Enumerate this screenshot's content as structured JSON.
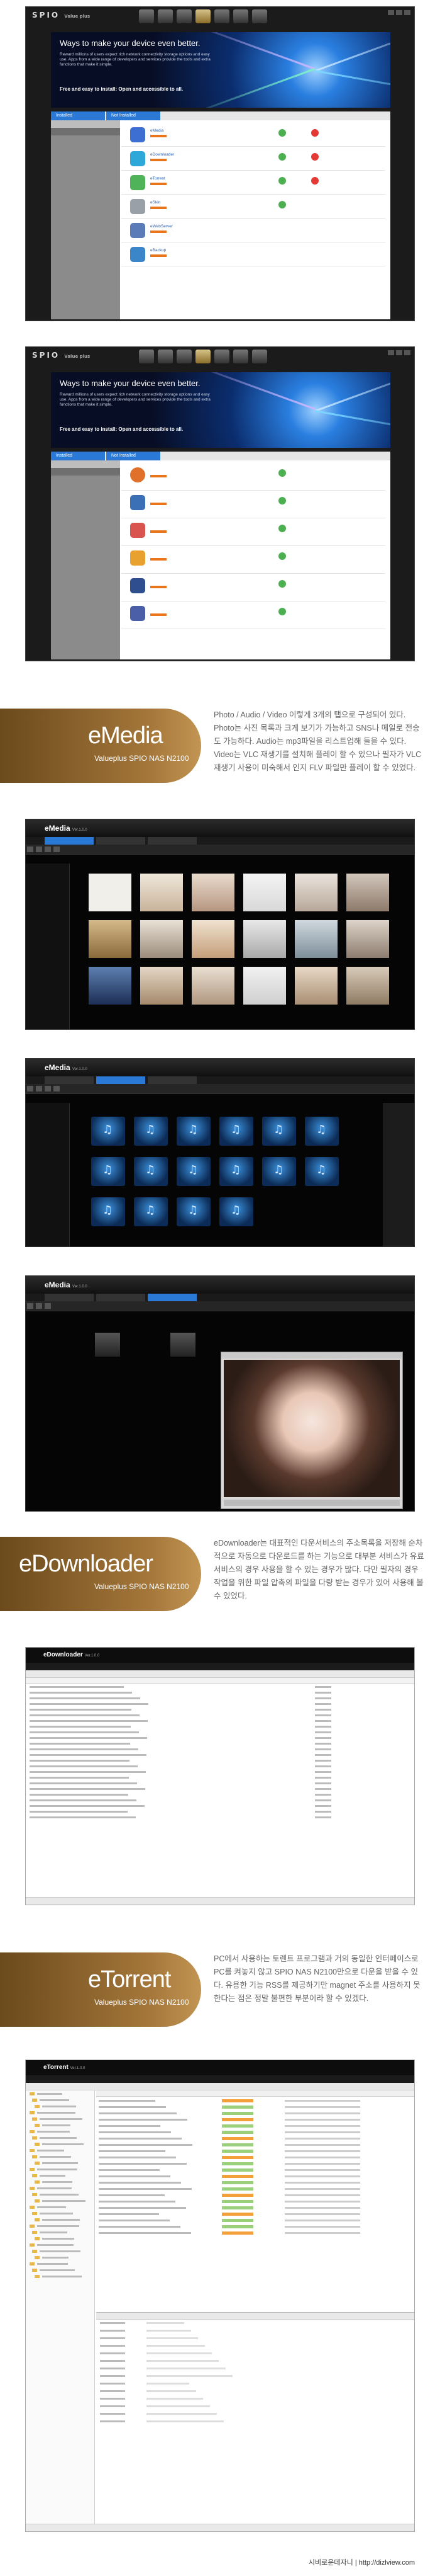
{
  "store1": {
    "brand": "SPIO",
    "brand_sub": "Value plus",
    "banner_title": "Ways to make your device even better.",
    "banner_text": "Reward millions of users expect rich network connectivity storage options and easy use. Apps from a wide range of developers and services provide the tools and extra functions that make it simple.",
    "banner_tag": "Free and easy to install: Open and accessible to all.",
    "tabs": [
      "Installed",
      "Not Installed"
    ],
    "apps": [
      "eMedia",
      "eDownloader",
      "eTorrent",
      "eSkin",
      "eWebServer",
      "eBackup"
    ]
  },
  "emedia": {
    "title": "eMedia",
    "subtitle": "Valueplus SPIO NAS N2100",
    "desc": "Photo / Audio / Video 이렇게 3개의 탭으로 구성되어 있다. Photo는 사진 목록과 크게 보기가 가능하고 SNS나 메일로 전송도 가능하다. Audio는 mp3파일을 리스트업해 들을 수 있다. Video는 VLC 재생기를 설치해 플레이 할 수 있으나 필자가 VLC 재생기 사용이 미숙해서 인지 FLV 파일만 플레이 할 수 있었다.",
    "app_logo": "eMedia",
    "app_ver": "Ver.1.0.0"
  },
  "edownloader": {
    "title": "eDownloader",
    "subtitle": "Valueplus SPIO NAS N2100",
    "desc": "eDownloader는 대표적인 다운서비스의 주소목록을 저장해 순차적으로 자동으로 다운로드를 하는 기능으로 대부분 서비스가 유료 서비스의 경우 사용을 할 수 있는 경우가 많다. 다만 필자의 경우 작업을 위한 파일 압축의 파일을 다량 받는 경우가 있어 사용해 볼 수 있었다.",
    "app_logo": "eDownloader",
    "app_ver": "Ver.1.0.0"
  },
  "etorrent": {
    "title": "eTorrent",
    "subtitle": "Valueplus SPIO NAS N2100",
    "desc": "PC에서 사용하는 토렌트 프로그램과 거의 동일한 인터페이스로 PC를 켜놓지 않고 SPIO NAS N2100만으로 다운을 받을 수 있다. 유용한 기능 RSS를 제공하기만 magnet 주소를 사용하지 못한다는 점은 정말 불편한 부분이라 할 수 있겠다.",
    "app_logo": "eTorrent",
    "app_ver": "Ver.1.0.0"
  },
  "footer": "시비로운데자니 | http://dizlview.com"
}
